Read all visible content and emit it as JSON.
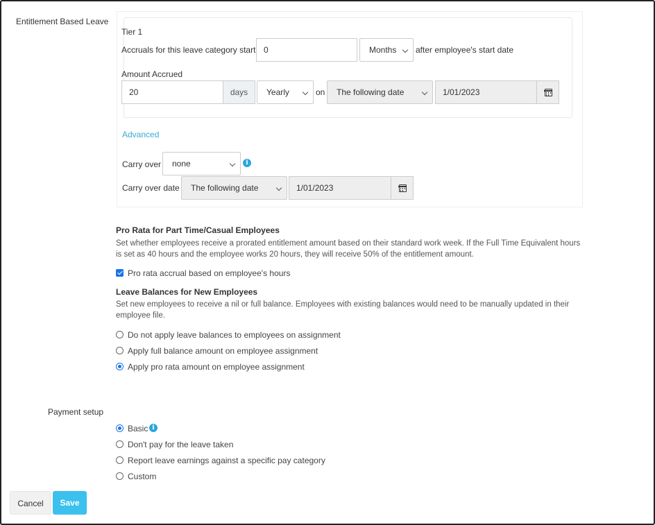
{
  "entitlement": {
    "section_label": "Entitlement Based Leave",
    "tier_title": "Tier 1",
    "accrual_start_prefix": "Accruals for this leave category start",
    "accrual_start_value": "0",
    "accrual_start_unit": "Months",
    "accrual_start_suffix": "after employee's start date",
    "amount_accrued_label": "Amount Accrued",
    "amount_value": "20",
    "amount_unit": "days",
    "frequency": "Yearly",
    "on_label": "on",
    "date_mode": "The following date",
    "date_value": "1/01/2023",
    "advanced_link": "Advanced",
    "carry_over_label": "Carry over",
    "carry_over_value": "none",
    "carry_over_date_label": "Carry over date",
    "carry_over_date_mode": "The following date",
    "carry_over_date_value": "1/01/2023"
  },
  "pro_rata": {
    "heading": "Pro Rata for Part Time/Casual Employees",
    "description": "Set whether employees receive a prorated entitlement amount based on their standard work week. If the Full Time Equivalent hours is set as 40 hours and the employee works 20 hours, they will receive 50% of the entitlement amount.",
    "checkbox_label": "Pro rata accrual based on employee's hours",
    "checked": true
  },
  "leave_balances": {
    "heading": "Leave Balances for New Employees",
    "description": "Set new employees to receive a nil or full balance. Employees with existing balances would need to be manually updated in their employee file.",
    "options": [
      {
        "label": "Do not apply leave balances to employees on assignment",
        "checked": false
      },
      {
        "label": "Apply full balance amount on employee assignment",
        "checked": false
      },
      {
        "label": "Apply pro rata amount on employee assignment",
        "checked": true
      }
    ]
  },
  "payment": {
    "section_label": "Payment setup",
    "options": [
      {
        "label": "Basic",
        "checked": true
      },
      {
        "label": "Don't pay for the leave taken",
        "checked": false
      },
      {
        "label": "Report leave earnings against a specific pay category",
        "checked": false
      },
      {
        "label": "Custom",
        "checked": false
      }
    ]
  },
  "actions": {
    "cancel_label": "Cancel",
    "save_label": "Save"
  },
  "colors": {
    "accent": "#3cc0ee",
    "link": "#3aabd2",
    "control_blue": "#1a73e8",
    "info": "#2ba6de"
  },
  "icons": {
    "calendar": "calendar-icon",
    "info": "info-icon",
    "chevron": "chevron-down-icon"
  }
}
